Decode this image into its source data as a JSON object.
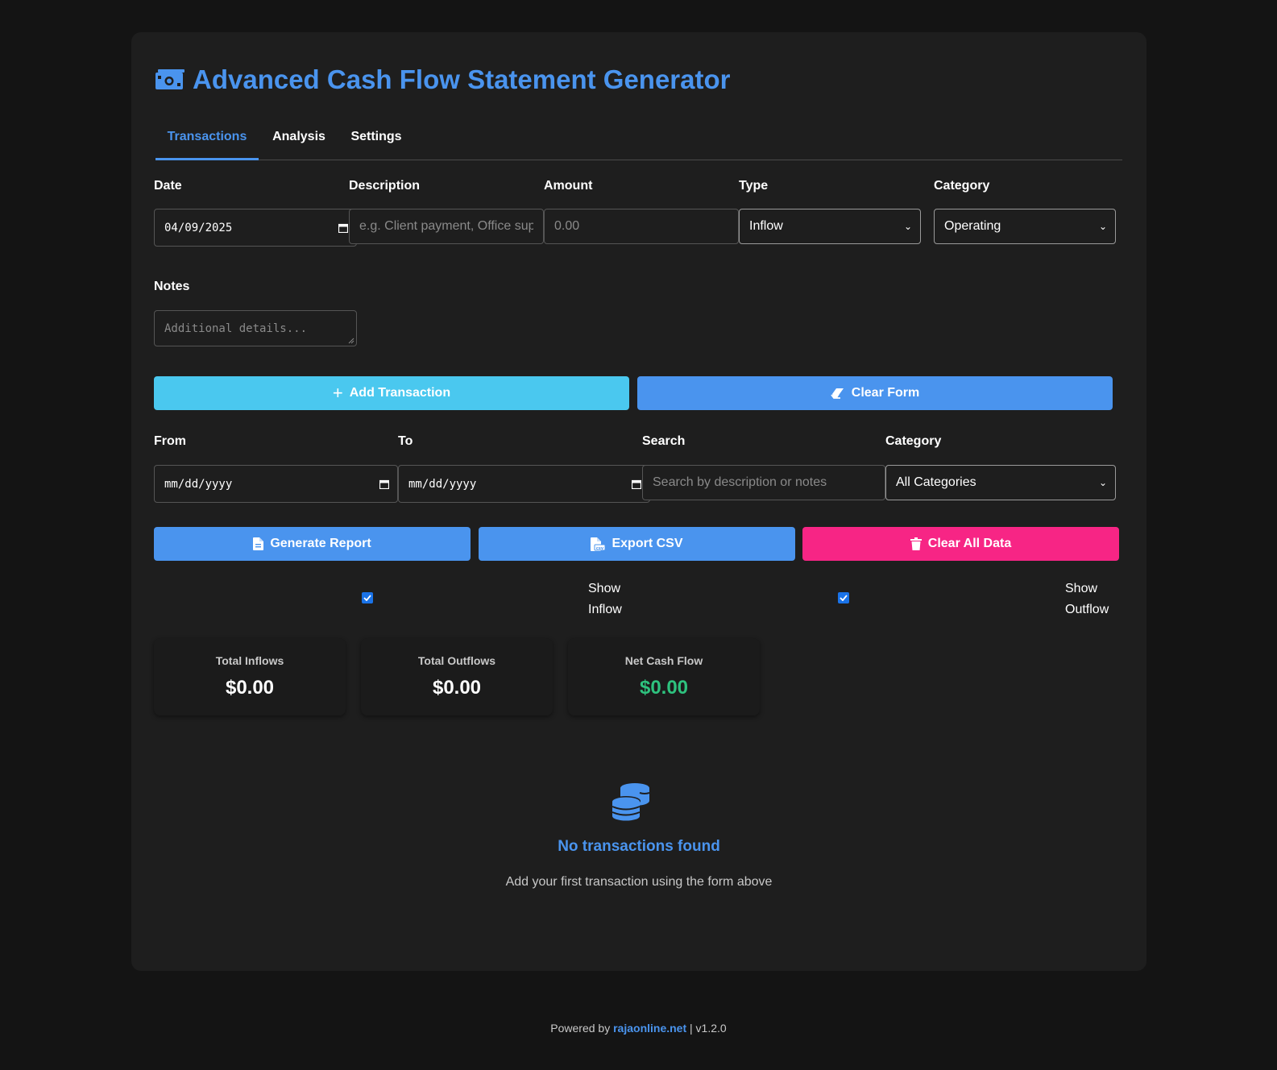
{
  "header": {
    "title": "Advanced Cash Flow Statement Generator",
    "icon": "money-bill-icon"
  },
  "tabs": [
    {
      "label": "Transactions",
      "active": true
    },
    {
      "label": "Analysis",
      "active": false
    },
    {
      "label": "Settings",
      "active": false
    }
  ],
  "form": {
    "date": {
      "label": "Date",
      "value": "04/09/2025"
    },
    "description": {
      "label": "Description",
      "placeholder": "e.g. Client payment, Office supp"
    },
    "amount": {
      "label": "Amount",
      "placeholder": "0.00"
    },
    "type": {
      "label": "Type",
      "value": "Inflow"
    },
    "category": {
      "label": "Category",
      "value": "Operating"
    },
    "notes": {
      "label": "Notes",
      "placeholder": "Additional details..."
    },
    "add_button": "Add Transaction",
    "clear_button": "Clear Form"
  },
  "filters": {
    "from": {
      "label": "From",
      "value": "mm/dd/yyyy"
    },
    "to": {
      "label": "To",
      "value": "mm/dd/yyyy"
    },
    "search": {
      "label": "Search",
      "placeholder": "Search by description or notes"
    },
    "category": {
      "label": "Category",
      "value": "All Categories"
    }
  },
  "actions": {
    "generate": "Generate Report",
    "export": "Export CSV",
    "clear_all": "Clear All Data"
  },
  "toggles": {
    "show_inflow": {
      "line1": "Show",
      "line2": "Inflow",
      "checked": true
    },
    "show_outflow": {
      "line1": "Show",
      "line2": "Outflow",
      "checked": true
    }
  },
  "summary": {
    "inflows": {
      "label": "Total Inflows",
      "value": "$0.00"
    },
    "outflows": {
      "label": "Total Outflows",
      "value": "$0.00"
    },
    "net": {
      "label": "Net Cash Flow",
      "value": "$0.00"
    }
  },
  "empty_state": {
    "title": "No transactions found",
    "subtitle": "Add your first transaction using the form above"
  },
  "footer": {
    "prefix": "Powered by",
    "link": "rajaonline.net",
    "version": "| v1.2.0"
  },
  "colors": {
    "accent": "#4a94ee",
    "cyan": "#4ac8ef",
    "danger": "#f72585",
    "positive": "#2ec27e"
  }
}
